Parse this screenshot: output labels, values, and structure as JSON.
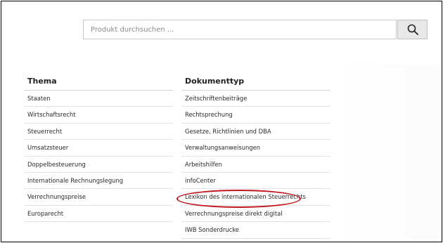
{
  "search": {
    "placeholder": "Produkt durchsuchen ...",
    "value": "",
    "button_icon": "search-icon"
  },
  "thema": {
    "title": "Thema",
    "items": [
      "Staaten",
      "Wirtschaftsrecht",
      "Steuerrecht",
      "Umsatzsteuer",
      "Doppelbesteuerung",
      "Internationale Rechnungslegung",
      "Verrechnungspreise",
      "Europarecht"
    ]
  },
  "dokumenttyp": {
    "title": "Dokumenttyp",
    "items": [
      "Zeitschriftenbeiträge",
      "Rechtsprechung",
      "Gesetze, Richtlinien und DBA",
      "Verwaltungsanweisungen",
      "Arbeitshilfen",
      "infoCenter",
      "Lexikon des internationalen Steuerrechts",
      "Verrechnungspreise direkt digital",
      "IWB Sonderdrucke"
    ]
  },
  "colors": {
    "highlight": "#c0151c",
    "border": "#d6d6d6"
  }
}
